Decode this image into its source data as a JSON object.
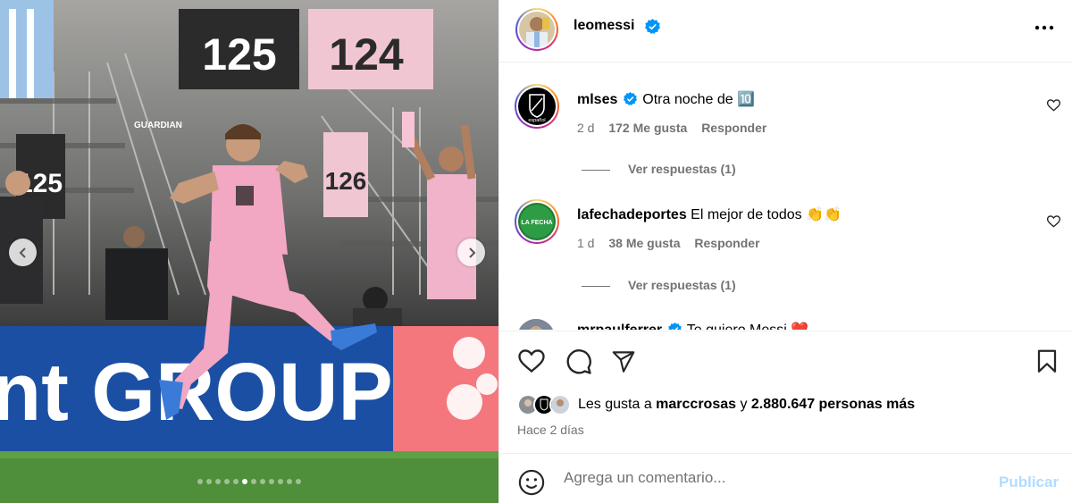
{
  "post": {
    "author": "leomessi",
    "more_icon": "more-horizontal-icon"
  },
  "media": {
    "icons": {
      "prev": "chevron-left-icon",
      "next": "chevron-right-icon"
    },
    "stand_signs": [
      "125",
      "124",
      "125",
      "126"
    ],
    "banner_text": "nt GROUP",
    "sponsor_text": "GUARDIAN",
    "carousel": {
      "total": 12,
      "active": 5
    }
  },
  "comments": [
    {
      "username": "mlses",
      "text": "Otra noche de 🔟",
      "age": "2 d",
      "likes": "172 Me gusta",
      "reply": "Responder",
      "view_replies": "Ver respuestas (1)"
    },
    {
      "username": "lafechadeportes",
      "text": "El mejor de todos 👏👏",
      "age": "1 d",
      "likes": "38 Me gusta",
      "reply": "Responder",
      "view_replies": "Ver respuestas (1)"
    },
    {
      "username": "mrpaulferrer",
      "text": "Te quiero Messi ❤️"
    }
  ],
  "avatar_labels": {
    "mlses": "español",
    "lafecha": "LA FECHA"
  },
  "actions": {
    "icons": [
      "heart-icon",
      "comment-icon",
      "share-icon",
      "bookmark-icon"
    ],
    "likes_prefix": "Les gusta a ",
    "likes_user": "marccrosas",
    "likes_mid": " y ",
    "likes_count": "2.880.647 personas más",
    "time_ago": "Hace 2 días"
  },
  "comment_box": {
    "placeholder": "Agrega un comentario...",
    "publish": "Publicar",
    "emoji_icon": "emoji-icon"
  },
  "colors": {
    "verified": "#0095f6",
    "kit_pink": "#f2a7c3",
    "banner_blue": "#1b4fa3",
    "publish_disabled": "#b3dbff"
  }
}
